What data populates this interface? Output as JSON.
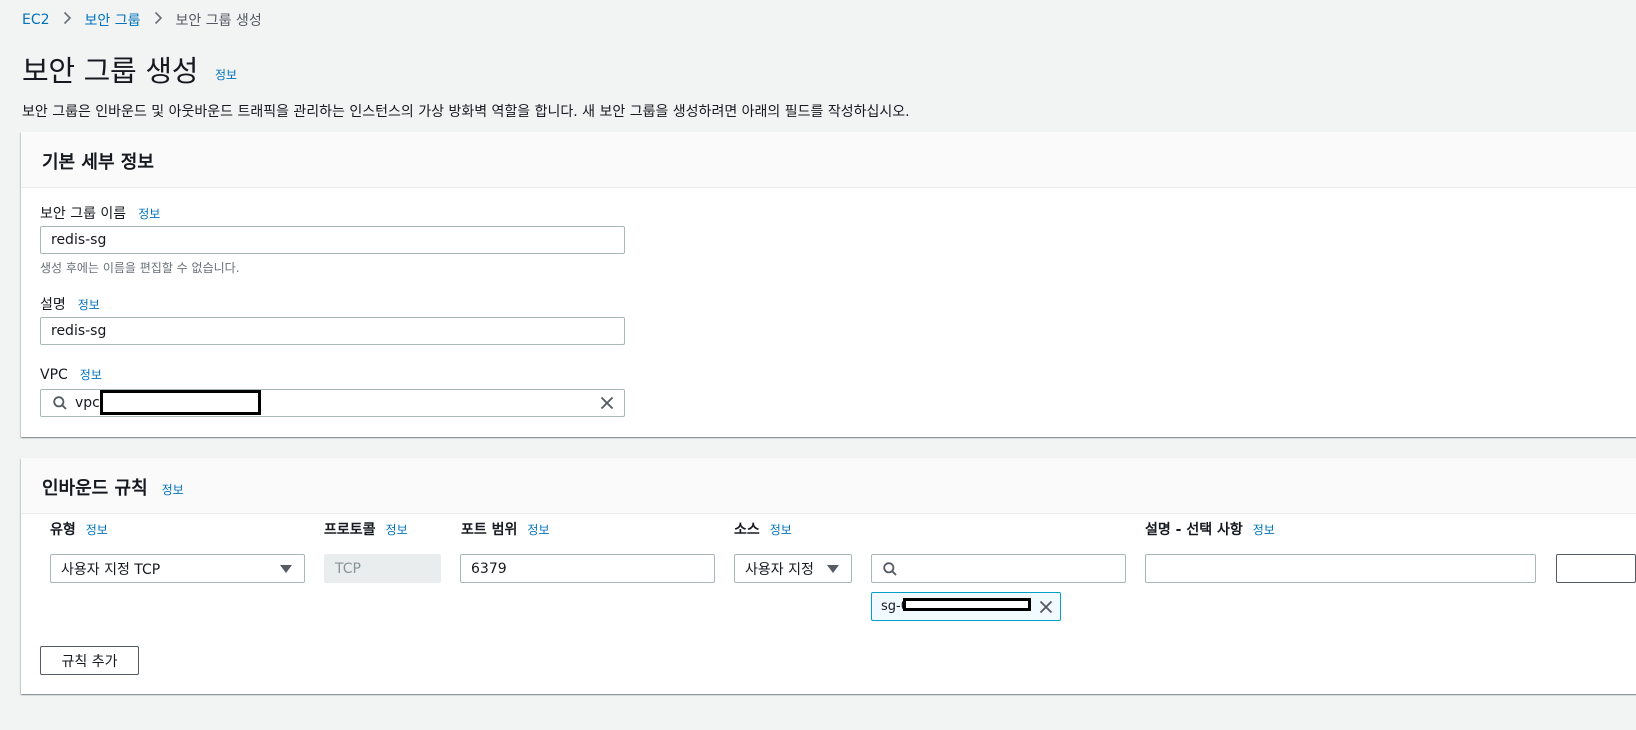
{
  "breadcrumb": {
    "root": "EC2",
    "parent": "보안 그룹",
    "current": "보안 그룹 생성"
  },
  "page": {
    "title": "보안 그룹 생성",
    "info": "정보",
    "description": "보안 그룹은 인바운드 및 아웃바운드 트래픽을 관리하는 인스턴스의 가상 방화벽 역할을 합니다. 새 보안 그룹을 생성하려면 아래의 필드를 작성하십시오."
  },
  "basic": {
    "title": "기본 세부 정보",
    "name": {
      "label": "보안 그룹 이름",
      "info": "정보",
      "value": "redis-sg",
      "hint": "생성 후에는 이름을 편집할 수 없습니다."
    },
    "description": {
      "label": "설명",
      "info": "정보",
      "value": "redis-sg"
    },
    "vpc": {
      "label": "VPC",
      "info": "정보",
      "value": "vpc-"
    }
  },
  "inbound": {
    "title": "인바운드 규칙",
    "info": "정보",
    "columns": {
      "type": "유형",
      "protocol": "프로토콜",
      "port": "포트 범위",
      "source": "소스",
      "desc": "설명 - 선택 사항",
      "info": "정보"
    },
    "rule": {
      "type": "사용자 지정 TCP",
      "protocol": "TCP",
      "port": "6379",
      "source": "사용자 지정",
      "token": "sg-0",
      "desc": ""
    },
    "add_button": "규칙 추가"
  },
  "icons": {
    "search": "search-icon",
    "close": "close-icon",
    "chevron": "chevron-right-icon",
    "caret": "caret-down-icon"
  },
  "colors": {
    "link": "#0073bb",
    "background": "#f2f3f3",
    "token_border": "#00a1c9"
  }
}
